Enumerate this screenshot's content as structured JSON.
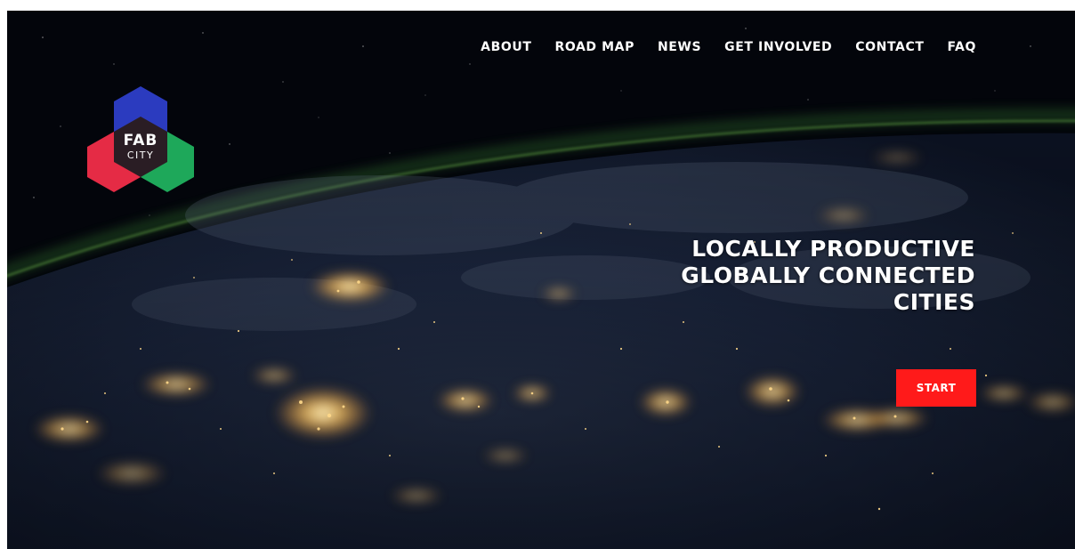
{
  "nav": {
    "items": [
      {
        "label": "ABOUT"
      },
      {
        "label": "ROAD MAP"
      },
      {
        "label": "NEWS"
      },
      {
        "label": "GET INVOLVED"
      },
      {
        "label": "CONTACT"
      },
      {
        "label": "FAQ"
      }
    ]
  },
  "logo": {
    "line1": "FAB",
    "line2": "CITY",
    "colors": {
      "top": "#2b3bbf",
      "left": "#e52b45",
      "right": "#1ea85a",
      "center": "#2a1d24"
    }
  },
  "hero": {
    "line1": "LOCALLY PRODUCTIVE",
    "line2": "GLOBALLY CONNECTED",
    "line3": "CITIES"
  },
  "cta": {
    "label": "START",
    "color": "#ff1a1a"
  },
  "background": {
    "description_icon": "earth-at-night-image"
  }
}
